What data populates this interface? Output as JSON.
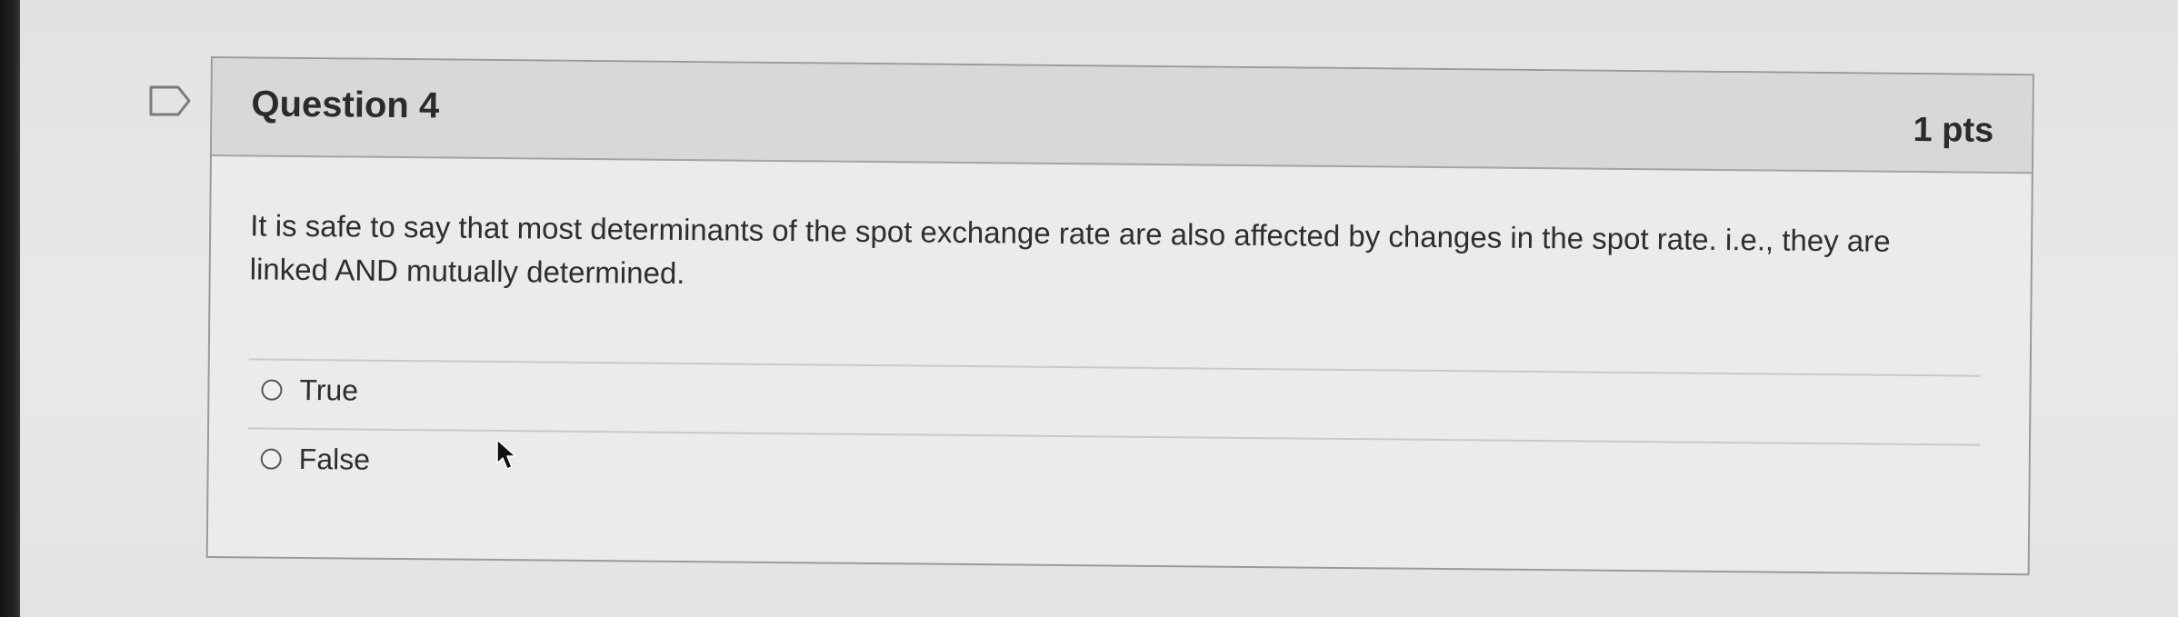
{
  "question": {
    "title": "Question 4",
    "points": "1 pts",
    "text": "It is safe to say that most determinants of the spot exchange rate are also affected by changes in the spot rate. i.e., they are linked AND mutually determined.",
    "answers": [
      {
        "label": "True",
        "selected": false
      },
      {
        "label": "False",
        "selected": false
      }
    ]
  },
  "icons": {
    "flag": "flag-icon",
    "cursor": "mouse-pointer-icon"
  }
}
